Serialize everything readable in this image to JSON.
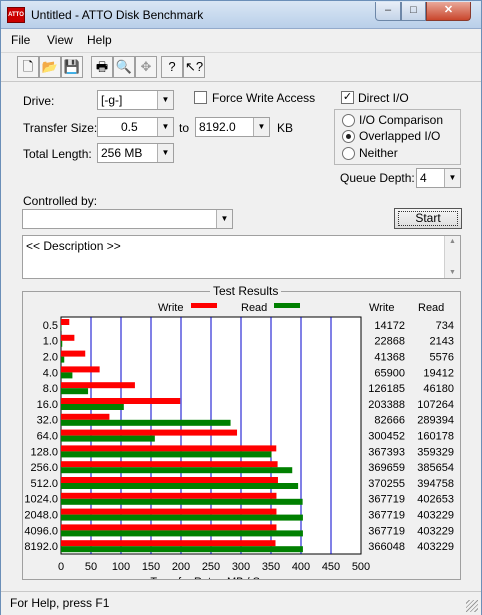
{
  "window": {
    "title": "Untitled - ATTO Disk Benchmark",
    "app_icon_label": "ATTO",
    "min_label": "–",
    "max_label": "□",
    "close_label": "✕"
  },
  "menu": [
    "File",
    "View",
    "Help"
  ],
  "toolbar": {
    "icons": [
      "new-file-icon",
      "open-folder-icon",
      "save-disk-icon",
      "print-icon",
      "print-preview-icon",
      "move-icon",
      "help-icon",
      "context-help-icon"
    ]
  },
  "settings": {
    "drive_label": "Drive:",
    "drive_value": "[-g-]",
    "transfer_size_label": "Transfer Size:",
    "transfer_min": "0.5",
    "to_label": "to",
    "transfer_max": "8192.0",
    "kb_label": "KB",
    "total_length_label": "Total Length:",
    "total_length_value": "256 MB",
    "force_write_label": "Force Write Access",
    "force_write_checked": false,
    "direct_io_label": "Direct I/O",
    "direct_io_checked": true,
    "io_comparison_label": "I/O Comparison",
    "overlapped_io_label": "Overlapped I/O",
    "neither_label": "Neither",
    "selected_io_mode": "Overlapped I/O",
    "queue_depth_label": "Queue Depth:",
    "queue_depth_value": "4",
    "controlled_by_label": "Controlled by:",
    "controlled_by_value": "",
    "start_label": "Start",
    "description_text": "<< Description >>"
  },
  "results": {
    "title": "Test Results",
    "write_label": "Write",
    "read_label": "Read",
    "write_col_header": "Write",
    "read_col_header": "Read"
  },
  "chart_data": {
    "type": "bar",
    "orientation": "horizontal",
    "title": "Test Results",
    "xlabel": "Transfer Rate - MB / Sec",
    "xlim": [
      0,
      500
    ],
    "xticks": [
      0,
      50,
      100,
      150,
      200,
      250,
      300,
      350,
      400,
      450,
      500
    ],
    "categories": [
      "0.5",
      "1.0",
      "2.0",
      "4.0",
      "8.0",
      "16.0",
      "32.0",
      "64.0",
      "128.0",
      "256.0",
      "512.0",
      "1024.0",
      "2048.0",
      "4096.0",
      "8192.0"
    ],
    "series": [
      {
        "name": "Write",
        "color": "#ff0000",
        "values": [
          13.8,
          22.3,
          40.4,
          64.4,
          123.2,
          198.6,
          80.7,
          293.4,
          358.8,
          361.0,
          361.6,
          359.1,
          359.1,
          359.1,
          357.5
        ]
      },
      {
        "name": "Read",
        "color": "#008000",
        "values": [
          0.7,
          2.1,
          5.4,
          19.0,
          45.1,
          104.7,
          282.6,
          156.4,
          350.9,
          385.4,
          395.2,
          402.7,
          403.2,
          403.2,
          403.2
        ]
      }
    ],
    "table": {
      "write": [
        "14172",
        "22868",
        "41368",
        "65900",
        "126185",
        "203388",
        "82666",
        "300452",
        "367393",
        "369659",
        "370255",
        "367719",
        "367719",
        "367719",
        "366048"
      ],
      "read": [
        "734",
        "2143",
        "5576",
        "19412",
        "46180",
        "107264",
        "289394",
        "160178",
        "359329",
        "385654",
        "394758",
        "402653",
        "403229",
        "403229",
        "403229"
      ]
    },
    "grid": true,
    "legend": "top"
  },
  "status": {
    "text": "For Help, press F1"
  }
}
